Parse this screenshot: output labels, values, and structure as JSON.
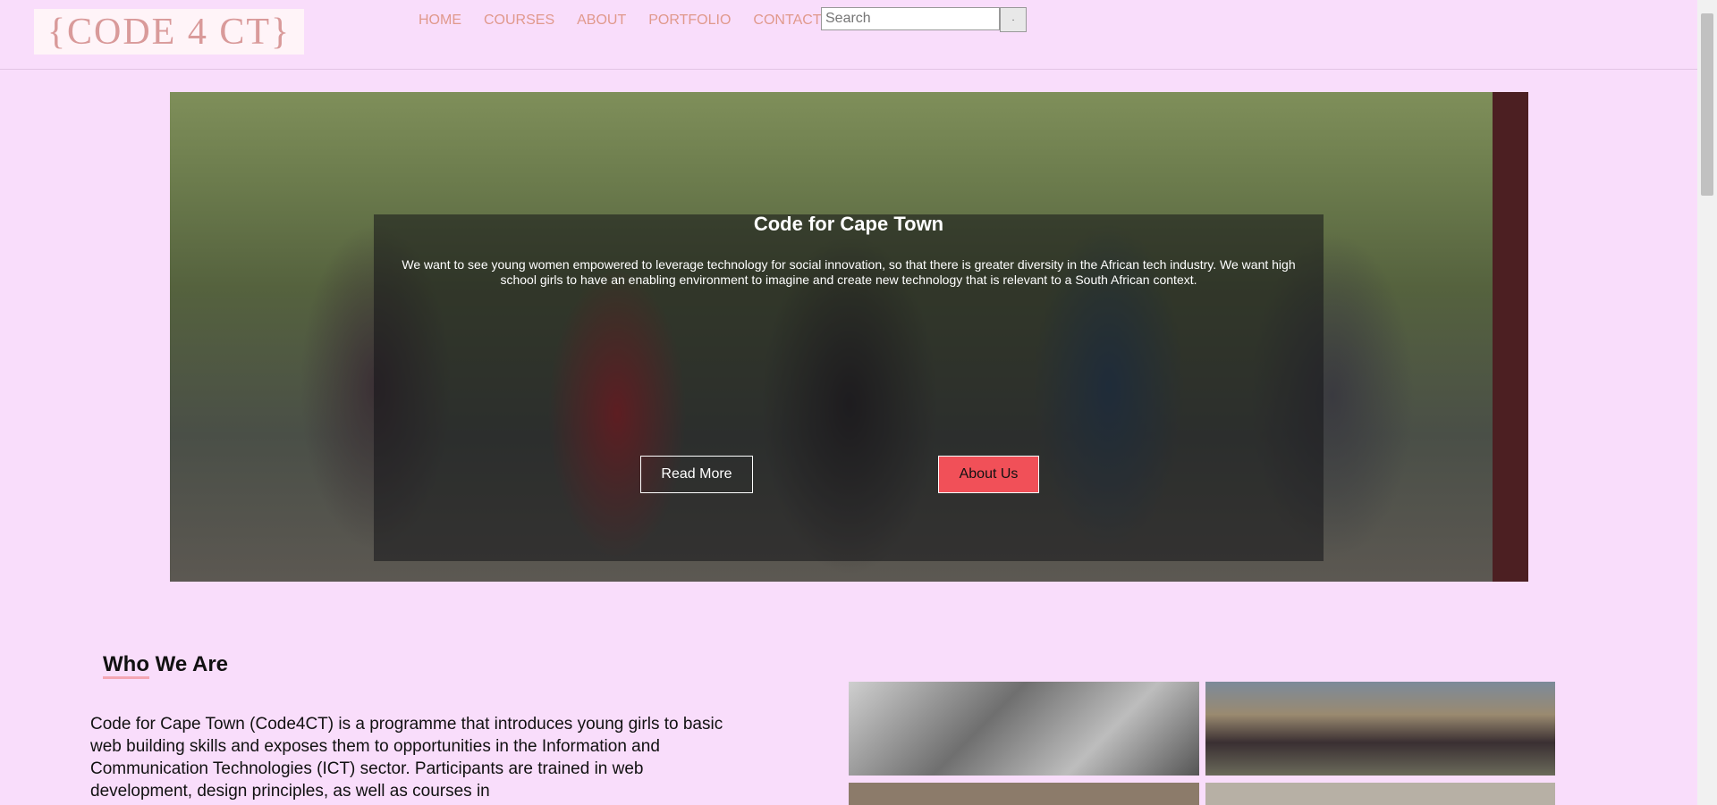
{
  "header": {
    "logo_text": "{CODE 4 CT}",
    "nav": [
      "HOME",
      "COURSES",
      "ABOUT",
      "PORTFOLIO",
      "CONTACT"
    ],
    "search_placeholder": "Search",
    "search_button": "·"
  },
  "hero": {
    "title": "Code for Cape Town",
    "text": "We want to see young women empowered to leverage technology for social innovation, so that there is greater diversity in the African tech industry. We want high school girls to have an enabling environment to imagine and create new technology that is relevant to a South African context.",
    "read_more": "Read More",
    "about_us": "About Us"
  },
  "who": {
    "title": "Who We Are",
    "body": "Code for Cape Town (Code4CT) is a programme that introduces young girls to basic web building skills and exposes them to opportunities in the Information and Communication Technologies (ICT) sector. Participants are trained in web development, design principles, as well as courses in"
  },
  "colors": {
    "background": "#f9ddfb",
    "nav_link": "#e0998c",
    "accent_button": "#f15058"
  }
}
